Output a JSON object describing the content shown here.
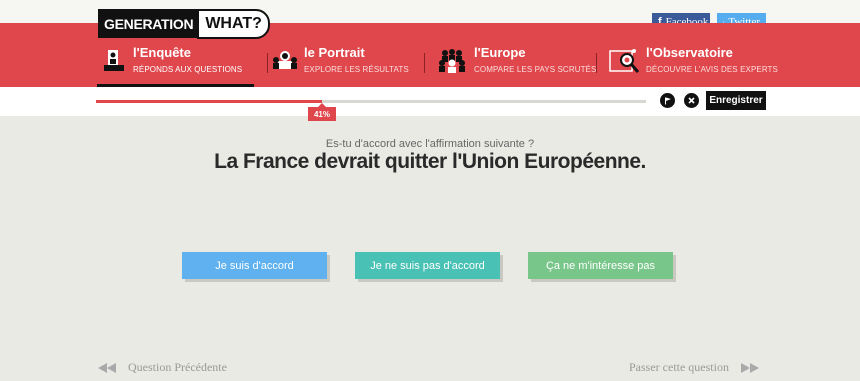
{
  "logo": {
    "part1": "GENERATION",
    "part2": "WHAT?"
  },
  "social": {
    "facebook": "Facebook",
    "twitter": "Twitter"
  },
  "nav": {
    "items": [
      {
        "title": "l'Enquête",
        "subtitle": "RÉPONDS AUX QUESTIONS",
        "icon": "survey-icon",
        "active": true
      },
      {
        "title": "le Portrait",
        "subtitle": "EXPLORE LES RÉSULTATS",
        "icon": "portrait-icon",
        "active": false
      },
      {
        "title": "l'Europe",
        "subtitle": "COMPARE LES PAYS SCRUTÉS",
        "icon": "europe-group-icon",
        "active": false
      },
      {
        "title": "l'Observatoire",
        "subtitle": "DÉCOUVRE L'AVIS DES EXPERTS",
        "icon": "magnifier-icon",
        "active": false
      }
    ]
  },
  "progress": {
    "percent": 41,
    "label": "41%"
  },
  "actions": {
    "flag_icon": "flag-icon",
    "close_icon": "close-icon",
    "save_label": "Enregistrer"
  },
  "question": {
    "intro": "Es-tu d'accord avec l'affirmation suivante ?",
    "text": "La France devrait quitter l'Union Européenne."
  },
  "answers": [
    {
      "label": "Je suis d'accord",
      "color": "#5fb1ef"
    },
    {
      "label": "Je ne suis pas d'accord",
      "color": "#49c1b5"
    },
    {
      "label": "Ça ne m'intéresse pas",
      "color": "#79c68a"
    }
  ],
  "footer": {
    "prev_label": "Question Précédente",
    "next_label": "Passer cette question"
  },
  "colors": {
    "brand_red": "#e0474c",
    "background": "#eaeae4"
  }
}
